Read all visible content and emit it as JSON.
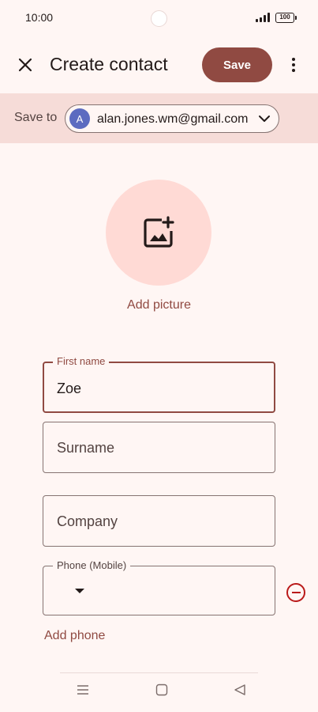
{
  "status_bar": {
    "time": "10:00",
    "battery": "100",
    "signal_icon": "signal-bars-icon",
    "battery_icon": "battery-icon"
  },
  "app_bar": {
    "close_icon": "close-icon",
    "title": "Create contact",
    "save_label": "Save",
    "more_icon": "more-vertical-icon"
  },
  "save_to": {
    "label": "Save to",
    "account_initial": "A",
    "account_email": "alan.jones.wm@gmail.com",
    "chevron_icon": "chevron-down-icon"
  },
  "picture": {
    "icon": "add-photo-icon",
    "label": "Add picture"
  },
  "form": {
    "first_name": {
      "label": "First name",
      "value": "Zoe",
      "focused": true
    },
    "surname": {
      "placeholder": "Surname"
    },
    "company": {
      "placeholder": "Company"
    },
    "phone": {
      "label": "Phone (Mobile)",
      "value": ""
    },
    "remove_icon": "remove-circle-icon",
    "add_phone_label": "Add phone"
  },
  "nav_bar": {
    "menu_icon": "menu-icon",
    "home_icon": "home-square-icon",
    "back_icon": "back-triangle-icon"
  },
  "colors": {
    "background": "#fff6f4",
    "primary": "#904a42",
    "save_to_bg": "#f6dcd8",
    "picture_circle": "#ffdad5",
    "error": "#ba1a1a",
    "avatar": "#5c6bc0"
  }
}
